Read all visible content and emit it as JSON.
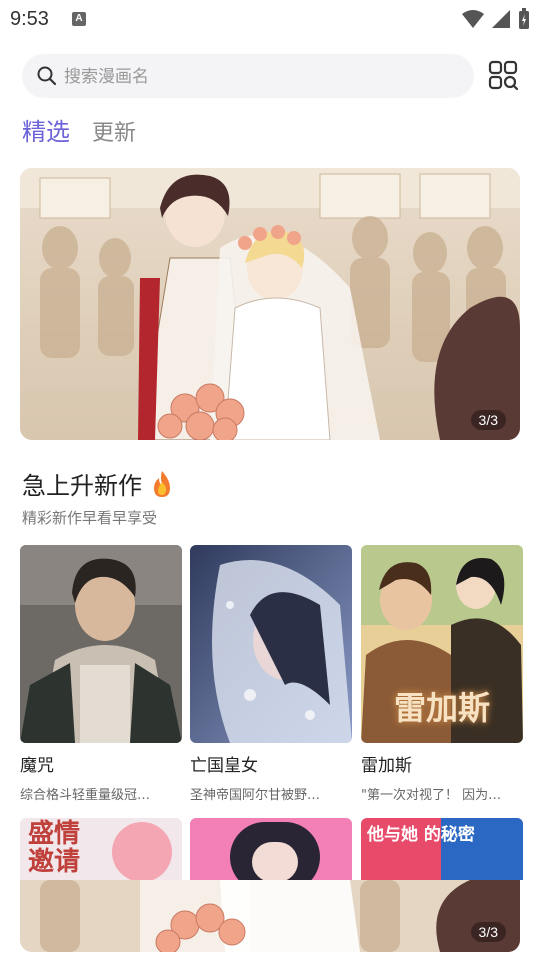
{
  "status": {
    "time": "9:53",
    "badge": "A"
  },
  "search": {
    "placeholder": "搜索漫画名"
  },
  "tabs": [
    {
      "label": "精选"
    },
    {
      "label": "更新"
    }
  ],
  "banner": {
    "counter": "3/3"
  },
  "section": {
    "title": "急上升新作",
    "subtitle": "精彩新作早看早享受"
  },
  "cards": [
    {
      "title": "魔咒",
      "desc": "综合格斗轻重量级冠…",
      "cover_overlay": ""
    },
    {
      "title": "亡国皇女",
      "desc": "圣神帝国阿尔甘被野…",
      "cover_overlay": ""
    },
    {
      "title": "雷加斯",
      "desc": "\"第一次对视了！ 因为…",
      "cover_overlay": "雷加斯"
    }
  ],
  "row2": [
    {
      "overlay": "盛情\n邀请"
    },
    {
      "overlay": ""
    },
    {
      "overlay": "他与她 的秘密"
    }
  ],
  "mini_banner": {
    "counter": "3/3"
  },
  "colors": {
    "accent": "#6c63d8",
    "text": "#222222",
    "muted": "#777777"
  }
}
